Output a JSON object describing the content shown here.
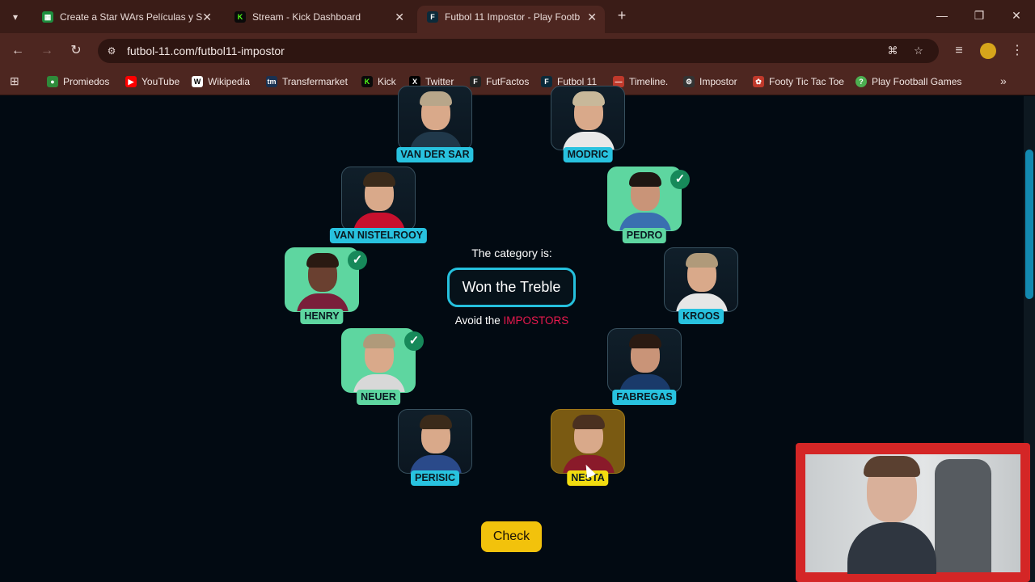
{
  "browser": {
    "tabs": [
      {
        "title": "Create a Star WArs Películas y S",
        "favicon": "sheets-icon",
        "favicon_color": "#1e8e3e",
        "active": false
      },
      {
        "title": "Stream - Kick Dashboard",
        "favicon": "kick-icon",
        "favicon_color": "#53fc18",
        "active": false
      },
      {
        "title": "Futbol 11 Impostor - Play Footb",
        "favicon": "futbol11-icon",
        "favicon_color": "#0b2a3a",
        "active": true
      }
    ],
    "url": "futbol-11.com/futbol11-impostor",
    "bookmarks": [
      {
        "label": "Promiedos",
        "icon": "promiedos-icon",
        "color": "#2e8b3a"
      },
      {
        "label": "YouTube",
        "icon": "youtube-icon",
        "color": "#ff0000"
      },
      {
        "label": "Wikipedia",
        "icon": "wikipedia-icon",
        "color": "#ffffff"
      },
      {
        "label": "Transfermarket",
        "icon": "transfermarkt-icon",
        "color": "#1a3151"
      },
      {
        "label": "Kick",
        "icon": "kick-icon",
        "color": "#53fc18"
      },
      {
        "label": "Twitter",
        "icon": "x-icon",
        "color": "#000000"
      },
      {
        "label": "FutFactos",
        "icon": "futfactos-icon",
        "color": "#222222"
      },
      {
        "label": "Futbol 11",
        "icon": "futbol11-icon",
        "color": "#0b2a3a"
      },
      {
        "label": "Timeline.",
        "icon": "timeline-icon",
        "color": "#c0392b"
      },
      {
        "label": "Impostor",
        "icon": "impostor-icon",
        "color": "#333333"
      },
      {
        "label": "Footy Tic Tac Toe",
        "icon": "footy-icon",
        "color": "#c0392b"
      },
      {
        "label": "Play Football Games",
        "icon": "help-icon",
        "color": "#4caf50"
      }
    ]
  },
  "game": {
    "category_intro": "The category is:",
    "category": "Won the Treble",
    "avoid_prefix": "Avoid the ",
    "avoid_word": "IMPOSTORS",
    "check_label": "Check",
    "players": [
      {
        "name": "VAN DER SAR",
        "state": "default"
      },
      {
        "name": "MODRIC",
        "state": "default"
      },
      {
        "name": "VAN NISTELROOY",
        "state": "default"
      },
      {
        "name": "PEDRO",
        "state": "correct"
      },
      {
        "name": "HENRY",
        "state": "correct"
      },
      {
        "name": "KROOS",
        "state": "default"
      },
      {
        "name": "NEUER",
        "state": "correct"
      },
      {
        "name": "FABREGAS",
        "state": "default"
      },
      {
        "name": "PERISIC",
        "state": "default"
      },
      {
        "name": "NESTA",
        "state": "hover"
      }
    ]
  },
  "colors": {
    "accent": "#25c0dd",
    "correct": "#5ed6a0",
    "hover": "#f2dc10",
    "impostor": "#e8194e",
    "button": "#f2c20c"
  }
}
